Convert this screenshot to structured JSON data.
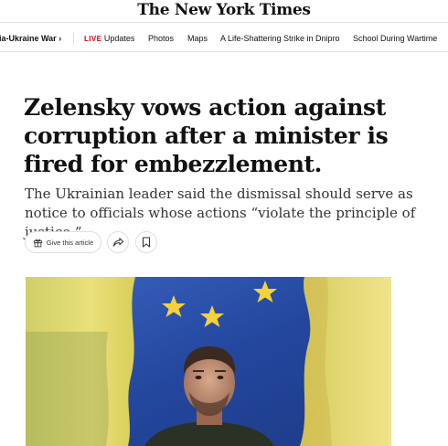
{
  "masthead": {
    "logo": "The New York Times"
  },
  "nav": {
    "items": [
      {
        "label": "ia-Ukraine War ›"
      },
      {
        "live": "LIVE",
        "label": "Updates"
      },
      {
        "label": "Photos"
      },
      {
        "label": "Maps"
      },
      {
        "label": "A Life-Shattering Strike in Dnipro"
      },
      {
        "label": "School During Wartime"
      }
    ]
  },
  "article": {
    "headline": "Zelensky vows action against corruption after a minister is fired for embezzlement.",
    "summary": "The Ukrainian leader said the dismissal should serve as notice to officials whose actions “violate the principle of justice.”",
    "gift_label": "Give this article"
  },
  "icons": {
    "gift": "gift-icon",
    "share": "share-arrow-icon",
    "save": "bookmark-icon"
  },
  "colors": {
    "live": "#d0021b",
    "flag_blue": "#2a4ea8",
    "flag_yellow": "#e8d84a",
    "star": "#f4d23a"
  }
}
